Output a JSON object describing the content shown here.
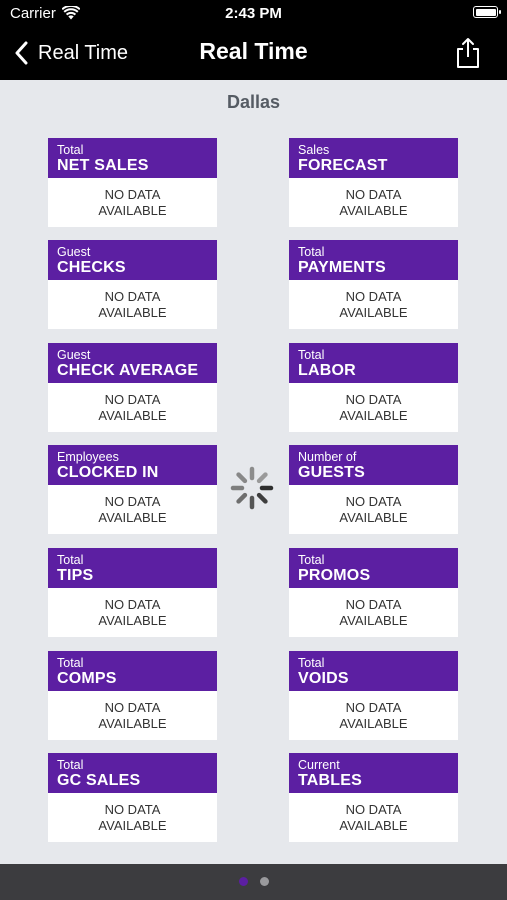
{
  "status": {
    "carrier": "Carrier",
    "time": "2:43 PM"
  },
  "nav": {
    "back_label": "Real Time",
    "title": "Real Time"
  },
  "location": "Dallas",
  "no_data": {
    "line1": "NO DATA",
    "line2": "AVAILABLE"
  },
  "cards": [
    {
      "subtitle": "Total",
      "title": "NET SALES"
    },
    {
      "subtitle": "Sales",
      "title": "FORECAST"
    },
    {
      "subtitle": "Guest",
      "title": "CHECKS"
    },
    {
      "subtitle": "Total",
      "title": "PAYMENTS"
    },
    {
      "subtitle": "Guest",
      "title": "CHECK AVERAGE"
    },
    {
      "subtitle": "Total",
      "title": "LABOR"
    },
    {
      "subtitle": "Employees",
      "title": "CLOCKED IN"
    },
    {
      "subtitle": "Number of",
      "title": "GUESTS"
    },
    {
      "subtitle": "Total",
      "title": "TIPS"
    },
    {
      "subtitle": "Total",
      "title": "PROMOS"
    },
    {
      "subtitle": "Total",
      "title": "COMPS"
    },
    {
      "subtitle": "Total",
      "title": "VOIDS"
    },
    {
      "subtitle": "Total",
      "title": "GC SALES"
    },
    {
      "subtitle": "Current",
      "title": "TABLES"
    }
  ],
  "page_indicator": {
    "pages": 2,
    "current": 1
  },
  "colors": {
    "accent": "#5c1fa2",
    "background": "#e6e8ec",
    "bar": "#000000"
  }
}
